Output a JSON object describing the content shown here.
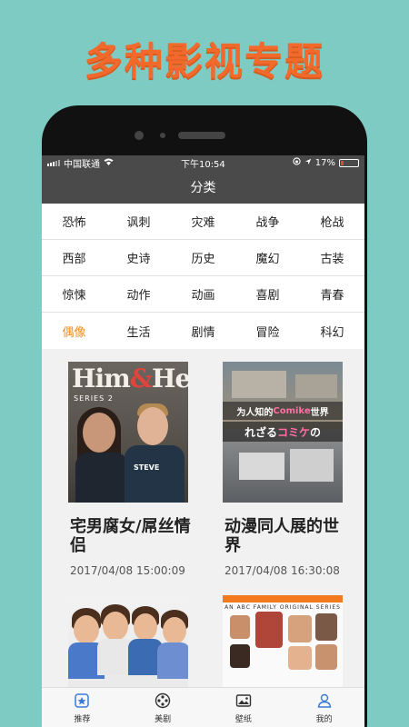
{
  "headline": "多种影视专题",
  "status": {
    "carrier": "中国联通",
    "time": "下午10:54",
    "battery": "17%",
    "battery_level": 0.17
  },
  "nav": {
    "title": "分类"
  },
  "categories": [
    [
      "恐怖",
      "讽刺",
      "灾难",
      "战争",
      "枪战"
    ],
    [
      "西部",
      "史诗",
      "历史",
      "魔幻",
      "古装"
    ],
    [
      "惊悚",
      "动作",
      "动画",
      "喜剧",
      "青春"
    ],
    [
      "偶像",
      "生活",
      "剧情",
      "冒险",
      "科幻"
    ]
  ],
  "active_category": "偶像",
  "cards": [
    {
      "title": "宅男腐女/屌丝情侣",
      "time": "2017/04/08 15:00:09",
      "poster": {
        "brand_a": "Him",
        "amp": "&",
        "brand_b": "Her",
        "series": "SERIES 2",
        "tag": "STEVE"
      }
    },
    {
      "title": "动漫同人展的世界",
      "time": "2017/04/08 16:30:08",
      "poster": {
        "line1_a": "为人知的 ",
        "line1_hl": "Comike",
        "line1_b": " 世界",
        "line2_a": "れざる",
        "line2_hl": "コミケ",
        "line2_b": "の"
      }
    },
    {
      "title": "",
      "time": "",
      "poster": {}
    },
    {
      "title": "",
      "time": "",
      "poster": {
        "top": "AN ABC FAMILY ORIGINAL SERIES"
      }
    }
  ],
  "tabs": [
    {
      "label": "推荐",
      "icon": "recommend-icon"
    },
    {
      "label": "美剧",
      "icon": "film-reel-icon"
    },
    {
      "label": "壁纸",
      "icon": "image-icon"
    },
    {
      "label": "我的",
      "icon": "user-icon"
    }
  ],
  "colors": {
    "accent": "#f08c1f",
    "headline": "#f26a2b",
    "background": "#7ecbc3"
  }
}
